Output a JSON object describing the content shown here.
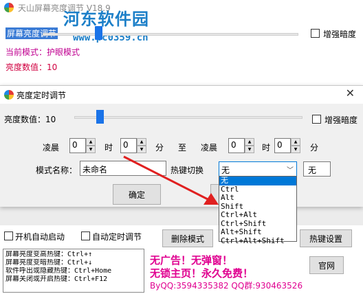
{
  "main_window": {
    "title": "天山屏幕亮度调节 V18.9",
    "screen_brightness_label": "屏幕亮度调节",
    "eye_protect_checkbox": "增强暗度",
    "current_mode": "当前模式：护眼模式",
    "brightness_value": "亮度数值：10",
    "autostart_label": "开机自动启动",
    "auto_timer_label": "自动定时调节",
    "delete_mode_button": "删除模式",
    "hotkey_settings_button": "热键设置",
    "website_button": "官网",
    "hotkey_lines": [
      "屏幕亮度变高热键：Ctrl+↑",
      "屏幕亮度变暗热键：Ctrl+↓",
      "软件呼出或隐藏热键：Ctrl+Home",
      "屏幕关闭或开启热键：Ctrl+F12"
    ],
    "promo_line_1": "无广告！无弹窗！",
    "promo_line_2": "无锁主页！永久免费！",
    "contact": "ByQQ:3594335382 QQ群:930463526"
  },
  "watermark": {
    "name": "河东软件园",
    "url": "www.pc0359.cn"
  },
  "dialog": {
    "title": "亮度定时调节",
    "brightness_value_label": "亮度数值：10",
    "eye_protect_checkbox": "增强暗度",
    "start_period_label": "凌晨",
    "start_hour": "0",
    "hour_unit": "时",
    "start_minute": "0",
    "minute_unit": "分",
    "to_label": "至",
    "end_period_label": "凌晨",
    "end_hour": "0",
    "end_minute": "0",
    "mode_name_label": "模式名称：",
    "mode_name_value": "未命名",
    "hotkey_switch_label": "热键切换",
    "hotkey_selected": "无",
    "hotkey_display": "无",
    "ok_button": "确定",
    "hotkey_options": [
      "无",
      "Ctrl",
      "Alt",
      "Shift",
      "Ctrl+Alt",
      "Ctrl+Shift",
      "Alt+Shift",
      "Ctrl+Alt+Shift"
    ],
    "hotkey_selected_index": 0
  },
  "colors": {
    "accent": "#0078d7",
    "slider_thumb": "#1a73e8",
    "mode_text": "#c00090",
    "value_text": "#d00040",
    "promo_text": "#e00090",
    "annotation_arrow": "#e02020",
    "watermark": "#1c7fc8"
  }
}
